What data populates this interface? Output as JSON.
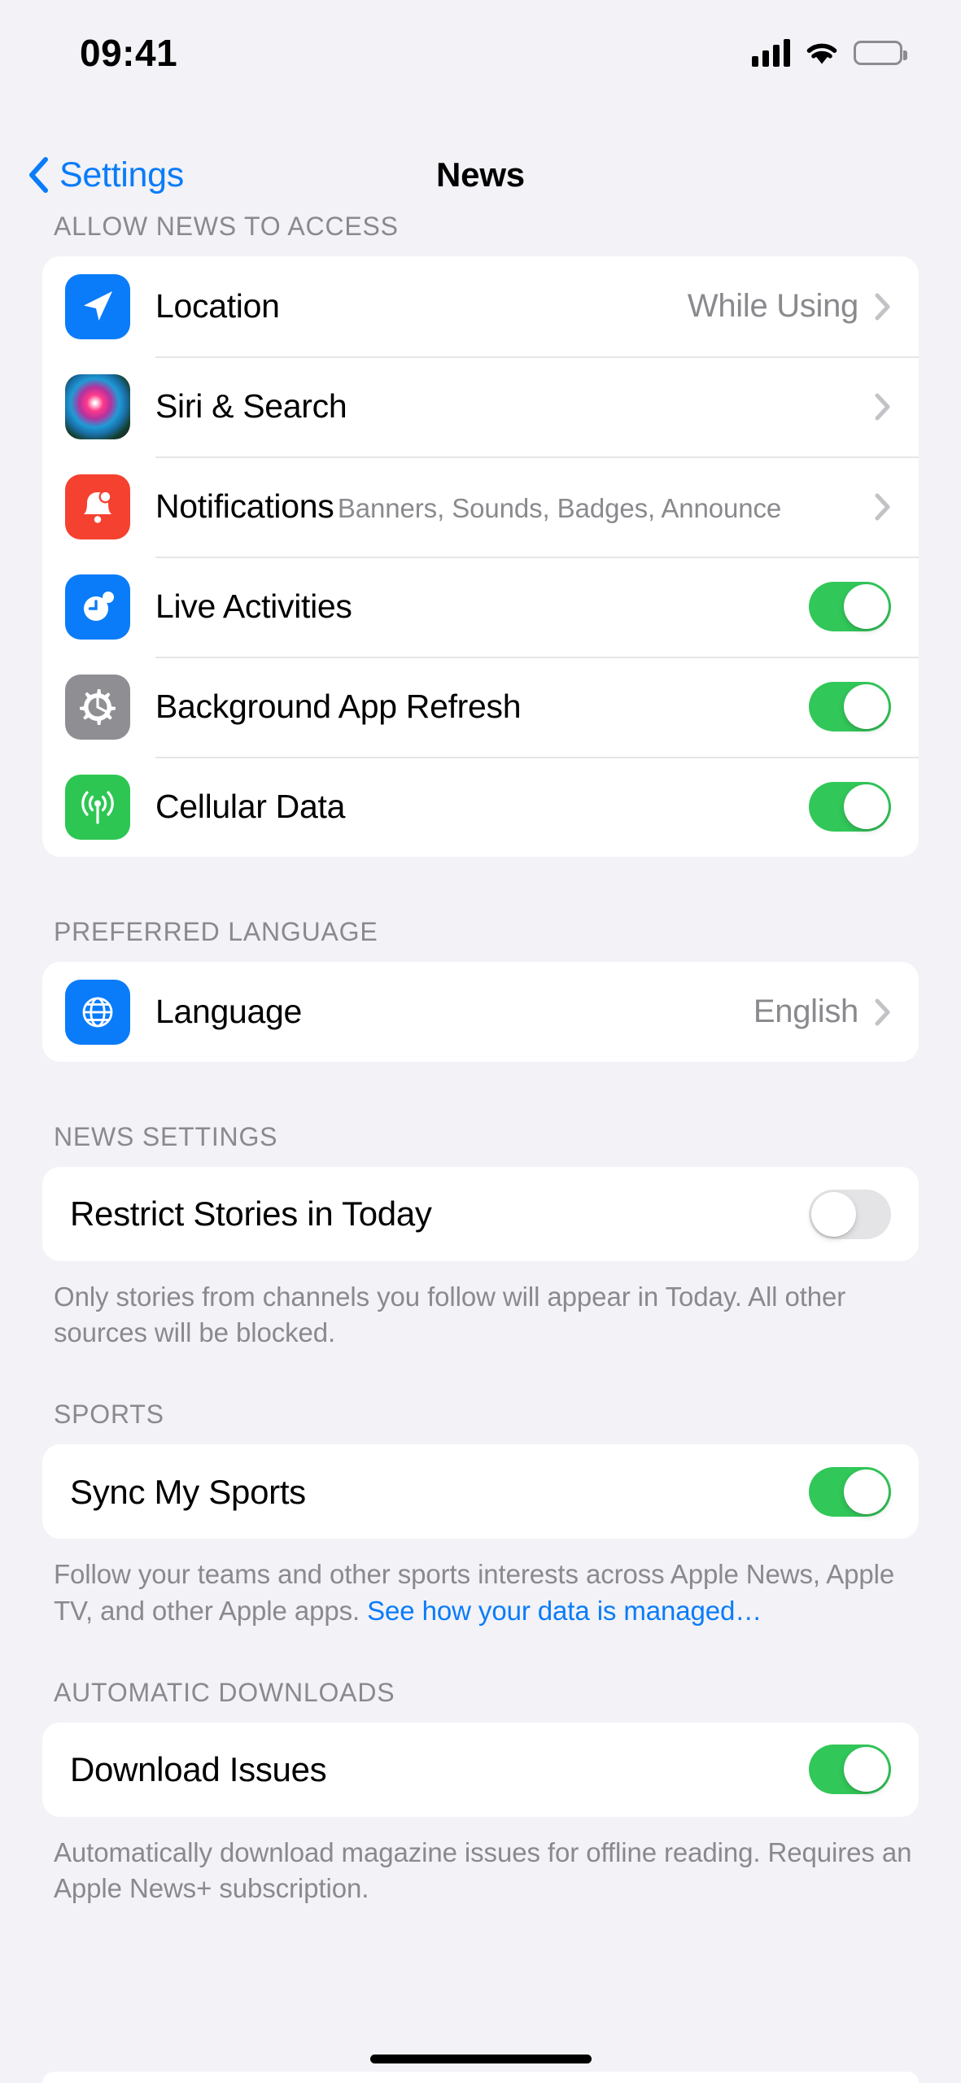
{
  "status_bar": {
    "time": "09:41",
    "cellular_icon": "cellular-bars-icon",
    "wifi_icon": "wifi-icon",
    "battery_icon": "battery-full-icon"
  },
  "nav": {
    "back_label": "Settings",
    "back_icon": "chevron-left-icon",
    "title": "News"
  },
  "sections": [
    {
      "header": "ALLOW NEWS TO ACCESS",
      "rows": [
        {
          "title": "Location",
          "value": "While Using",
          "icon": "location-arrow-icon",
          "accessory": "chevron"
        },
        {
          "title": "Siri & Search",
          "value": "",
          "icon": "siri-orb-icon",
          "accessory": "chevron"
        },
        {
          "title": "Notifications",
          "subtitle": "Banners, Sounds, Badges, Announce",
          "icon": "bell-icon",
          "accessory": "chevron"
        },
        {
          "title": "Live Activities",
          "icon": "live-activities-clock-icon",
          "accessory": "toggle",
          "toggle": "on"
        },
        {
          "title": "Background App Refresh",
          "icon": "gear-icon",
          "accessory": "toggle",
          "toggle": "on"
        },
        {
          "title": "Cellular Data",
          "icon": "cellular-antenna-icon",
          "accessory": "toggle",
          "toggle": "on"
        }
      ]
    },
    {
      "header": "PREFERRED LANGUAGE",
      "rows": [
        {
          "title": "Language",
          "value": "English",
          "icon": "globe-icon",
          "accessory": "chevron"
        }
      ]
    },
    {
      "header": "NEWS SETTINGS",
      "rows": [
        {
          "title": "Restrict Stories in Today",
          "accessory": "toggle",
          "toggle": "off"
        }
      ],
      "footer": "Only stories from channels you follow will appear in Today. All other sources will be blocked."
    },
    {
      "header": "SPORTS",
      "rows": [
        {
          "title": "Sync My Sports",
          "accessory": "toggle",
          "toggle": "on"
        }
      ],
      "footer_prefix": "Follow your teams and other sports interests across Apple News, Apple TV, and other Apple apps. ",
      "footer_link": "See how your data is managed…"
    },
    {
      "header": "AUTOMATIC DOWNLOADS",
      "rows": [
        {
          "title": "Download Issues",
          "accessory": "toggle",
          "toggle": "on"
        }
      ],
      "footer": "Automatically download magazine issues for offline reading. Requires an Apple News+ subscription."
    }
  ],
  "colors": {
    "accent_blue": "#0a7cf9",
    "toggle_on_green": "#32c759",
    "toggle_off_gray": "#e4e4e6",
    "background": "#f2f2f7",
    "card": "#ffffff",
    "secondary_text": "#8a8a8e"
  }
}
